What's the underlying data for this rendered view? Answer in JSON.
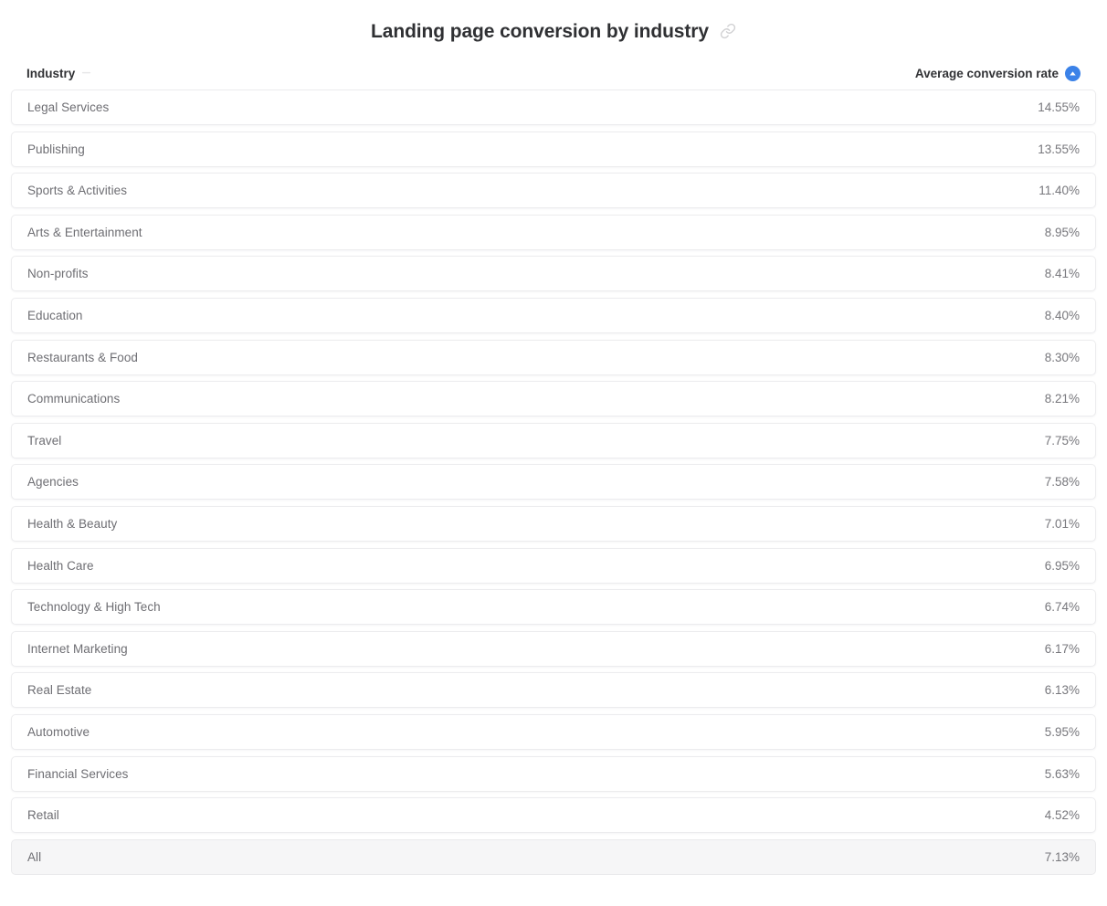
{
  "header": {
    "title": "Landing page conversion by industry",
    "link_icon": "link-chain-icon"
  },
  "table": {
    "columns": {
      "industry": {
        "label": "Industry",
        "sort_icon": "sort-inactive-icon",
        "sort_state": "none"
      },
      "rate": {
        "label": "Average conversion rate",
        "sort_icon": "caret-up-icon",
        "sort_state": "descending",
        "accent_color": "#3b82e8"
      }
    }
  },
  "chart_data": {
    "type": "table",
    "title": "Landing page conversion by industry",
    "xlabel": "Industry",
    "ylabel": "Average conversion rate",
    "categories": [
      "Legal Services",
      "Publishing",
      "Sports & Activities",
      "Arts & Entertainment",
      "Non-profits",
      "Education",
      "Restaurants & Food",
      "Communications",
      "Travel",
      "Agencies",
      "Health & Beauty",
      "Health Care",
      "Technology & High Tech",
      "Internet Marketing",
      "Real Estate",
      "Automotive",
      "Financial Services",
      "Retail",
      "All"
    ],
    "values": [
      14.55,
      13.55,
      11.4,
      8.95,
      8.41,
      8.4,
      8.3,
      8.21,
      7.75,
      7.58,
      7.01,
      6.95,
      6.74,
      6.17,
      6.13,
      5.95,
      5.63,
      4.52,
      7.13
    ],
    "value_labels": [
      "14.55%",
      "13.55%",
      "11.40%",
      "8.95%",
      "8.41%",
      "8.40%",
      "8.30%",
      "8.21%",
      "7.75%",
      "7.58%",
      "7.01%",
      "6.95%",
      "6.74%",
      "6.17%",
      "6.13%",
      "5.95%",
      "5.63%",
      "4.52%",
      "7.13%"
    ],
    "rows": [
      {
        "label": "Legal Services",
        "value": "14.55%",
        "total": false
      },
      {
        "label": "Publishing",
        "value": "13.55%",
        "total": false
      },
      {
        "label": "Sports & Activities",
        "value": "11.40%",
        "total": false
      },
      {
        "label": "Arts & Entertainment",
        "value": "8.95%",
        "total": false
      },
      {
        "label": "Non-profits",
        "value": "8.41%",
        "total": false
      },
      {
        "label": "Education",
        "value": "8.40%",
        "total": false
      },
      {
        "label": "Restaurants & Food",
        "value": "8.30%",
        "total": false
      },
      {
        "label": "Communications",
        "value": "8.21%",
        "total": false
      },
      {
        "label": "Travel",
        "value": "7.75%",
        "total": false
      },
      {
        "label": "Agencies",
        "value": "7.58%",
        "total": false
      },
      {
        "label": "Health & Beauty",
        "value": "7.01%",
        "total": false
      },
      {
        "label": "Health Care",
        "value": "6.95%",
        "total": false
      },
      {
        "label": "Technology & High Tech",
        "value": "6.74%",
        "total": false
      },
      {
        "label": "Internet Marketing",
        "value": "6.17%",
        "total": false
      },
      {
        "label": "Real Estate",
        "value": "6.13%",
        "total": false
      },
      {
        "label": "Automotive",
        "value": "5.95%",
        "total": false
      },
      {
        "label": "Financial Services",
        "value": "5.63%",
        "total": false
      },
      {
        "label": "Retail",
        "value": "4.52%",
        "total": false
      },
      {
        "label": "All",
        "value": "7.13%",
        "total": true
      }
    ]
  }
}
